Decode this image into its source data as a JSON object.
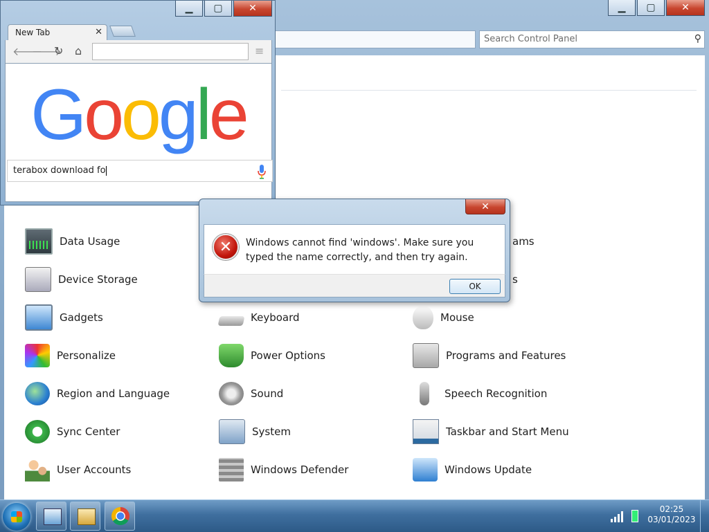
{
  "control_panel": {
    "search_placeholder": "Search Control Panel",
    "items": [
      {
        "label": "Data Usage",
        "icon": "data-usage-icon"
      },
      {
        "label": "Device Storage",
        "icon": "device-storage-icon"
      },
      {
        "label": "Gadgets",
        "icon": "gadgets-icon"
      },
      {
        "label": "Personalize",
        "icon": "personalize-icon"
      },
      {
        "label": "Region and Language",
        "icon": "region-language-icon"
      },
      {
        "label": "Sync Center",
        "icon": "sync-center-icon"
      },
      {
        "label": "User Accounts",
        "icon": "user-accounts-icon"
      },
      {
        "label": "Keyboard",
        "icon": "keyboard-icon"
      },
      {
        "label": "Power Options",
        "icon": "power-options-icon"
      },
      {
        "label": "Sound",
        "icon": "sound-icon"
      },
      {
        "label": "System",
        "icon": "system-icon"
      },
      {
        "label": "Windows Defender",
        "icon": "windows-defender-icon"
      },
      {
        "label": "Mouse",
        "icon": "mouse-icon"
      },
      {
        "label": "Programs and Features",
        "icon": "programs-features-icon"
      },
      {
        "label": "Speech Recognition",
        "icon": "speech-recognition-icon"
      },
      {
        "label": "Taskbar and Start Menu",
        "icon": "taskbar-start-menu-icon"
      },
      {
        "label": "Windows Update",
        "icon": "windows-update-icon"
      }
    ],
    "partial_labels": [
      "ams",
      "s"
    ]
  },
  "browser": {
    "tab_title": "New Tab",
    "logo_text": "Google",
    "logo_colors": [
      "#4285F4",
      "#EA4335",
      "#FBBC05",
      "#4285F4",
      "#34A853",
      "#EA4335"
    ],
    "search_text": "terabox download fo"
  },
  "dialog": {
    "message": "Windows cannot find 'windows'. Make sure you typed the name correctly, and then try again.",
    "ok_label": "OK",
    "close_glyph": "✕"
  },
  "taskbar": {
    "time": "02:25",
    "date": "03/01/2023",
    "apps": [
      "control-panel",
      "windows-explorer",
      "chrome"
    ]
  }
}
